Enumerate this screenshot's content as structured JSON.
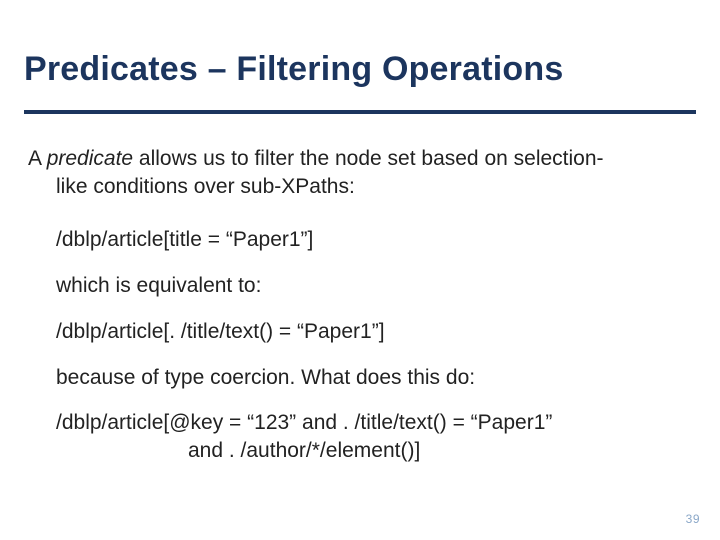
{
  "title": "Predicates – Filtering Operations",
  "lead": {
    "pre": "A ",
    "word": "predicate",
    "post_line1": "  allows us to filter the node set based on selection-",
    "post_line2": "like conditions over sub-XPaths:"
  },
  "lines": {
    "code1": "/dblp/article[title = “Paper1”]",
    "plain1": "which is equivalent to:",
    "code2": "/dblp/article[. /title/text() = “Paper1”]",
    "plain2": "because of type coercion.  What does this do:",
    "code3a": "/dblp/article[@key = “123” and . /title/text() = “Paper1”",
    "code3b": "and . /author/*/element()]"
  },
  "pagenum": "39"
}
